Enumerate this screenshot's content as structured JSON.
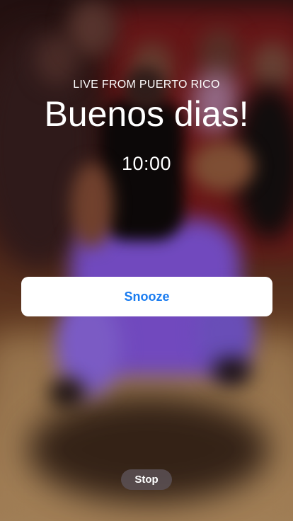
{
  "alarm": {
    "subtitle": "LIVE FROM PUERTO RICO",
    "headline": "Buenos dias!",
    "time": "10:00"
  },
  "actions": {
    "snooze_label": "Snooze",
    "stop_label": "Stop"
  },
  "colors": {
    "accent": "#1a7cf0",
    "snooze_bg": "#ffffff",
    "stop_bg": "#5a5055",
    "text": "#ffffff"
  }
}
